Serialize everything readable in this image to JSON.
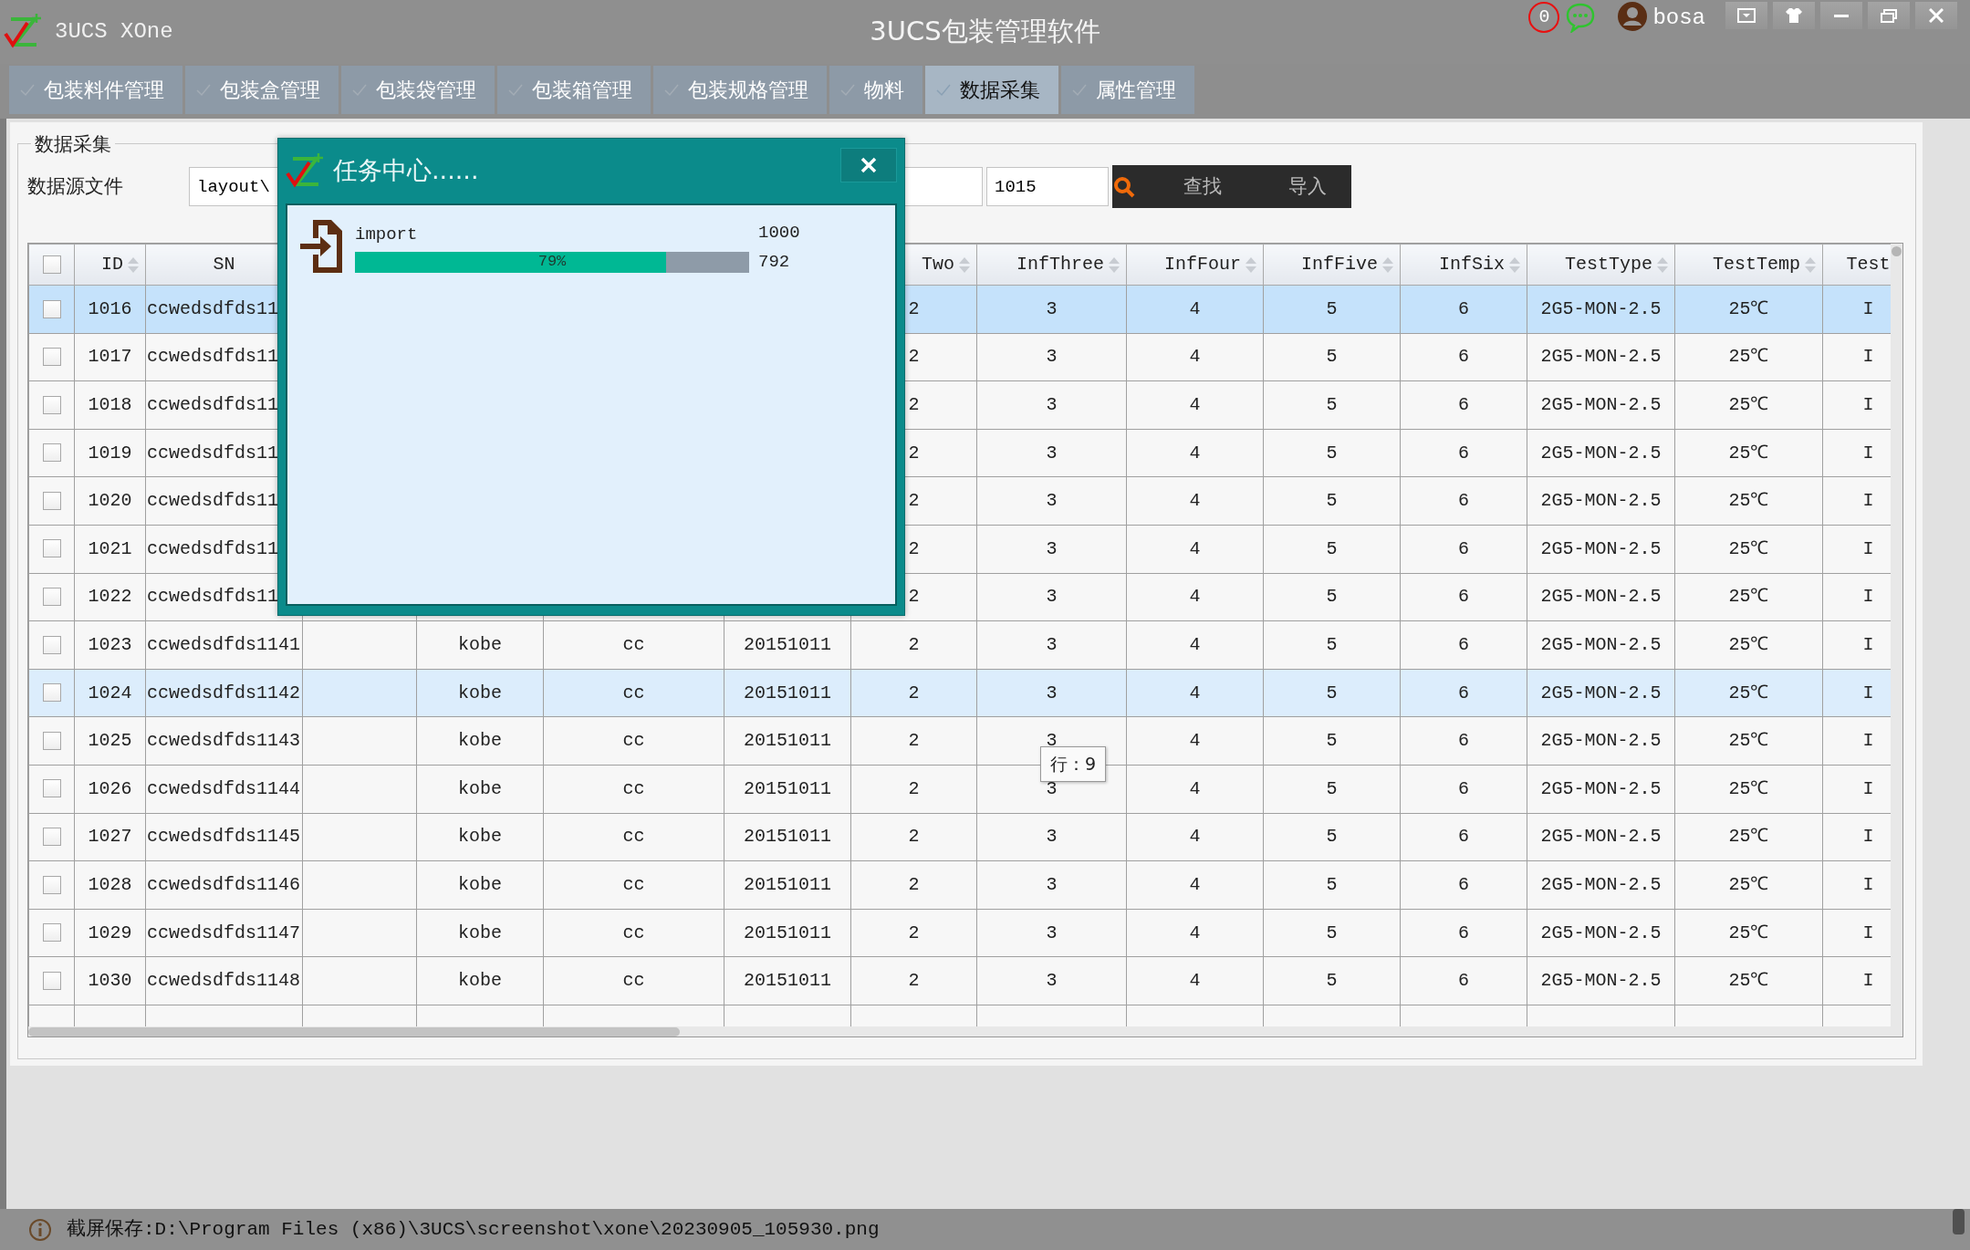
{
  "window": {
    "app_name": "3UCS XOne",
    "title": "3UCS包装管理软件",
    "notification_count": "0",
    "user": "bosa"
  },
  "tabs": [
    {
      "label": "包装料件管理",
      "selected": false
    },
    {
      "label": "包装盒管理",
      "selected": false
    },
    {
      "label": "包装袋管理",
      "selected": false
    },
    {
      "label": "包装箱管理",
      "selected": false
    },
    {
      "label": "包装规格管理",
      "selected": false
    },
    {
      "label": "物料",
      "selected": false
    },
    {
      "label": "数据采集",
      "selected": true
    },
    {
      "label": "属性管理",
      "selected": false
    }
  ],
  "group": {
    "title": "数据采集",
    "source_label": "数据源文件",
    "source_path": "layout\\",
    "number": "1015",
    "buttons": [
      "查找",
      "导入"
    ]
  },
  "table": {
    "header_checked": false,
    "columns": [
      {
        "label": "ID",
        "sortable": true
      },
      {
        "label": "SN",
        "sortable": false
      },
      {},
      {},
      {},
      {},
      {
        "label": "Two",
        "sortable": true
      },
      {
        "label": "InfThree",
        "sortable": true
      },
      {
        "label": "InfFour",
        "sortable": true
      },
      {
        "label": "InfFive",
        "sortable": true
      },
      {
        "label": "InfSix",
        "sortable": true
      },
      {
        "label": "TestType",
        "sortable": true
      },
      {
        "label": "TestTemp",
        "sortable": true
      },
      {
        "label": "Test",
        "sortable": false
      }
    ],
    "rows": [
      {
        "checked": false,
        "selected": true,
        "highlighted": false,
        "cells": [
          "1016",
          "ccwedsdfds11",
          null,
          null,
          null,
          null,
          "2",
          "3",
          "4",
          "5",
          "6",
          "2G5-MON-2.5",
          "25℃",
          "I"
        ]
      },
      {
        "checked": false,
        "selected": false,
        "highlighted": false,
        "cells": [
          "1017",
          "ccwedsdfds11",
          null,
          null,
          null,
          null,
          "2",
          "3",
          "4",
          "5",
          "6",
          "2G5-MON-2.5",
          "25℃",
          "I"
        ]
      },
      {
        "checked": false,
        "selected": false,
        "highlighted": false,
        "cells": [
          "1018",
          "ccwedsdfds11",
          null,
          null,
          null,
          null,
          "2",
          "3",
          "4",
          "5",
          "6",
          "2G5-MON-2.5",
          "25℃",
          "I"
        ]
      },
      {
        "checked": false,
        "selected": false,
        "highlighted": false,
        "cells": [
          "1019",
          "ccwedsdfds11",
          null,
          null,
          null,
          null,
          "2",
          "3",
          "4",
          "5",
          "6",
          "2G5-MON-2.5",
          "25℃",
          "I"
        ]
      },
      {
        "checked": false,
        "selected": false,
        "highlighted": false,
        "cells": [
          "1020",
          "ccwedsdfds11",
          null,
          null,
          null,
          null,
          "2",
          "3",
          "4",
          "5",
          "6",
          "2G5-MON-2.5",
          "25℃",
          "I"
        ]
      },
      {
        "checked": false,
        "selected": false,
        "highlighted": false,
        "cells": [
          "1021",
          "ccwedsdfds11",
          null,
          null,
          null,
          null,
          "2",
          "3",
          "4",
          "5",
          "6",
          "2G5-MON-2.5",
          "25℃",
          "I"
        ]
      },
      {
        "checked": false,
        "selected": false,
        "highlighted": false,
        "cells": [
          "1022",
          "ccwedsdfds11",
          null,
          null,
          null,
          null,
          "2",
          "3",
          "4",
          "5",
          "6",
          "2G5-MON-2.5",
          "25℃",
          "I"
        ]
      },
      {
        "checked": false,
        "selected": false,
        "highlighted": false,
        "cells": [
          "1023",
          "ccwedsdfds1141",
          null,
          "kobe",
          "cc",
          "20151011",
          "2",
          "3",
          "4",
          "5",
          "6",
          "2G5-MON-2.5",
          "25℃",
          "I"
        ]
      },
      {
        "checked": false,
        "selected": false,
        "highlighted": true,
        "cells": [
          "1024",
          "ccwedsdfds1142",
          null,
          "kobe",
          "cc",
          "20151011",
          "2",
          "3",
          "4",
          "5",
          "6",
          "2G5-MON-2.5",
          "25℃",
          "I"
        ]
      },
      {
        "checked": false,
        "selected": false,
        "highlighted": false,
        "cells": [
          "1025",
          "ccwedsdfds1143",
          null,
          "kobe",
          "cc",
          "20151011",
          "2",
          "3",
          "4",
          "5",
          "6",
          "2G5-MON-2.5",
          "25℃",
          "I"
        ]
      },
      {
        "checked": false,
        "selected": false,
        "highlighted": false,
        "cells": [
          "1026",
          "ccwedsdfds1144",
          null,
          "kobe",
          "cc",
          "20151011",
          "2",
          "3",
          "4",
          "5",
          "6",
          "2G5-MON-2.5",
          "25℃",
          "I"
        ]
      },
      {
        "checked": false,
        "selected": false,
        "highlighted": false,
        "cells": [
          "1027",
          "ccwedsdfds1145",
          null,
          "kobe",
          "cc",
          "20151011",
          "2",
          "3",
          "4",
          "5",
          "6",
          "2G5-MON-2.5",
          "25℃",
          "I"
        ]
      },
      {
        "checked": false,
        "selected": false,
        "highlighted": false,
        "cells": [
          "1028",
          "ccwedsdfds1146",
          null,
          "kobe",
          "cc",
          "20151011",
          "2",
          "3",
          "4",
          "5",
          "6",
          "2G5-MON-2.5",
          "25℃",
          "I"
        ]
      },
      {
        "checked": false,
        "selected": false,
        "highlighted": false,
        "cells": [
          "1029",
          "ccwedsdfds1147",
          null,
          "kobe",
          "cc",
          "20151011",
          "2",
          "3",
          "4",
          "5",
          "6",
          "2G5-MON-2.5",
          "25℃",
          "I"
        ]
      },
      {
        "checked": false,
        "selected": false,
        "highlighted": false,
        "cells": [
          "1030",
          "ccwedsdfds1148",
          null,
          "kobe",
          "cc",
          "20151011",
          "2",
          "3",
          "4",
          "5",
          "6",
          "2G5-MON-2.5",
          "25℃",
          "I"
        ]
      }
    ]
  },
  "tooltip": "行：9",
  "dialog": {
    "title": "任务中心......",
    "task": {
      "name": "import",
      "total": "1000",
      "done": "792",
      "percent": "79%",
      "level": 0.79
    }
  },
  "status_bar": "截屏保存:D:\\Program Files (x86)\\3UCS\\screenshot\\xone\\20230905_105930.png"
}
